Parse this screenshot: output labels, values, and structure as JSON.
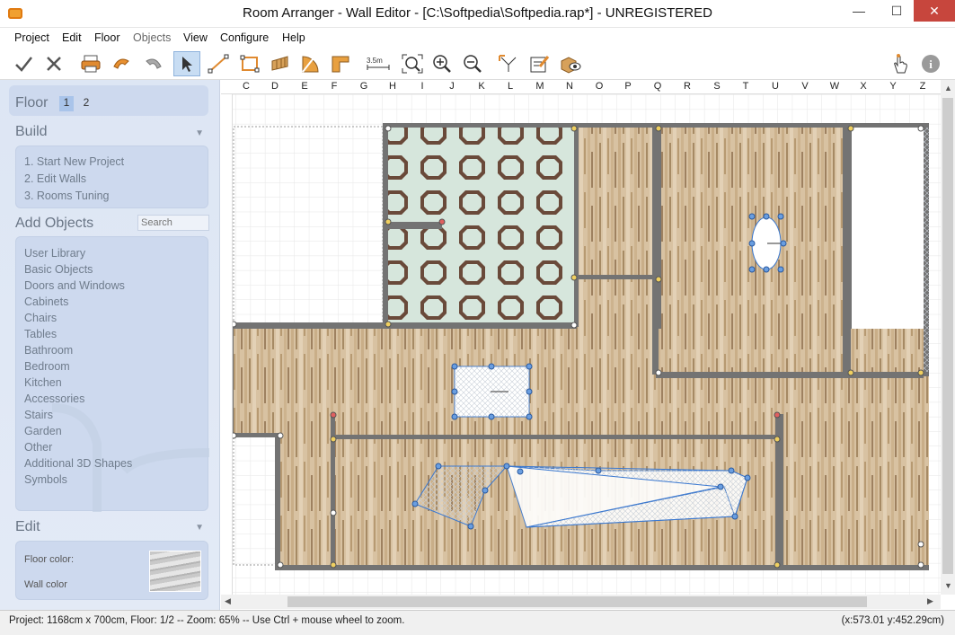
{
  "window": {
    "title": "Room Arranger - Wall Editor - [C:\\Softpedia\\Softpedia.rap*] - UNREGISTERED",
    "minimize": "—",
    "maximize": "☐",
    "close": "✕"
  },
  "menu": [
    "Project",
    "Edit",
    "Floor",
    "Objects",
    "View",
    "Configure",
    "Help"
  ],
  "toolbar": {
    "ruler_label": "3.5m",
    "icons": [
      "check-icon",
      "cancel-icon",
      "print-icon",
      "undo-icon",
      "redo-icon",
      "select-arrow-icon",
      "line-tool-icon",
      "rectangle-tool-icon",
      "wall-tool-icon",
      "door-tool-icon",
      "room-tool-icon",
      "measure-tool-icon",
      "zoom-fit-icon",
      "zoom-in-icon",
      "zoom-out-icon",
      "dimension-icon",
      "edit-properties-icon",
      "3d-view-icon",
      "hand-pointer-icon",
      "info-icon"
    ]
  },
  "sidebar": {
    "floor_label": "Floor",
    "floors": [
      "1",
      "2"
    ],
    "build_label": "Build",
    "build_items": [
      "1. Start New Project",
      "2. Edit Walls",
      "3. Rooms Tuning"
    ],
    "add_objects_label": "Add Objects",
    "search_placeholder": "Search",
    "object_categories": [
      "User Library",
      "Basic Objects",
      "Doors and Windows",
      "Cabinets",
      "Chairs",
      "Tables",
      "Bathroom",
      "Bedroom",
      "Kitchen",
      "Accessories",
      "Stairs",
      "Garden",
      "Other",
      "Additional 3D Shapes",
      "Symbols"
    ],
    "edit_label": "Edit",
    "floor_color_label": "Floor color:",
    "wall_color_label": "Wall color"
  },
  "ruler": {
    "columns": [
      "C",
      "D",
      "E",
      "F",
      "G",
      "H",
      "I",
      "J",
      "K",
      "L",
      "M",
      "N",
      "O",
      "P",
      "Q",
      "R",
      "S",
      "T",
      "U",
      "V",
      "W",
      "X",
      "Y",
      "Z"
    ]
  },
  "status": {
    "left": "Project: 1168cm x 700cm, Floor: 1/2 -- Zoom: 65% -- Use Ctrl + mouse wheel to zoom.",
    "right": "(x:573.01 y:452.29cm)"
  },
  "colors": {
    "wall": "#737373",
    "wood_light": "#d8c2a2",
    "wood_dark": "#a68a64",
    "tile_base": "#d6e6dc",
    "tile_octagon": "#6a4a3a",
    "selection": "#3a78d0",
    "close_button": "#c7463d"
  }
}
